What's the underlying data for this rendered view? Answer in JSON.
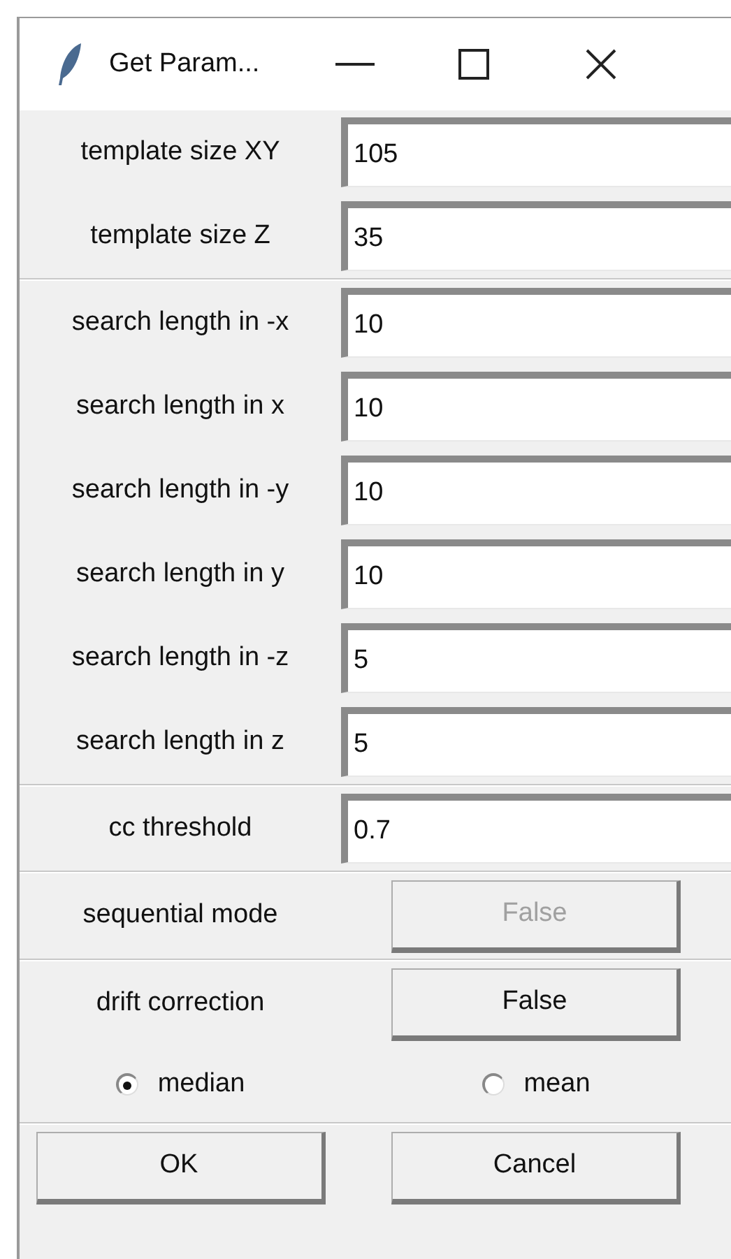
{
  "window": {
    "title": "Get Param..."
  },
  "sections": [
    {
      "kind": "fields",
      "rows": [
        {
          "label": "template size XY",
          "value": "105"
        },
        {
          "label": "template size Z",
          "value": "35"
        }
      ]
    },
    {
      "kind": "fields",
      "rows": [
        {
          "label": "search length in -x",
          "value": "10"
        },
        {
          "label": "search length in x",
          "value": "10"
        },
        {
          "label": "search length in -y",
          "value": "10"
        },
        {
          "label": "search length in y",
          "value": "10"
        },
        {
          "label": "search length in -z",
          "value": "5"
        },
        {
          "label": "search length in z",
          "value": "5"
        }
      ]
    },
    {
      "kind": "fields",
      "rows": [
        {
          "label": "cc threshold",
          "value": "0.7"
        }
      ]
    },
    {
      "kind": "toggle",
      "label": "sequential mode",
      "value": "False",
      "disabled": true
    },
    {
      "kind": "toggle",
      "label": "drift correction",
      "value": "False",
      "disabled": false,
      "options": [
        {
          "label": "median",
          "selected": true
        },
        {
          "label": "mean",
          "selected": false
        }
      ]
    }
  ],
  "buttons": [
    "OK",
    "Cancel"
  ]
}
